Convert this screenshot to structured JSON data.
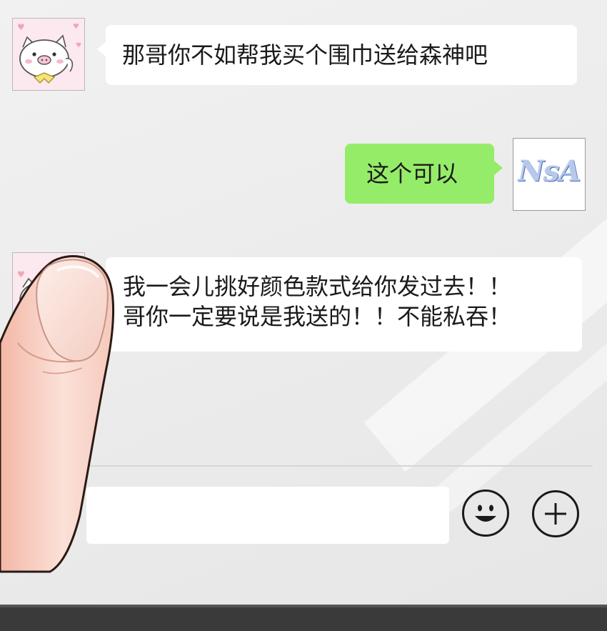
{
  "messages": [
    {
      "side": "left",
      "avatar": "pig-avatar",
      "lines": [
        "那哥你不如帮我买个围巾送给森神吧"
      ]
    },
    {
      "side": "right",
      "avatar": "nsa-avatar",
      "lines": [
        "这个可以"
      ]
    },
    {
      "side": "left",
      "avatar": "pig-avatar",
      "lines": [
        "我一会儿挑好颜色款式给你发过去！！",
        "哥你一定要说是我送的！！不能私吞！"
      ]
    }
  ],
  "right_avatar": {
    "text": "NsA"
  },
  "input": {
    "value": "",
    "placeholder": ""
  },
  "icons": {
    "voice": "voice-icon",
    "emoji": "emoji-icon",
    "plus": "plus-icon"
  },
  "colors": {
    "right_bubble": "#95ec69",
    "left_bubble": "#ffffff",
    "background": "#ececec"
  }
}
